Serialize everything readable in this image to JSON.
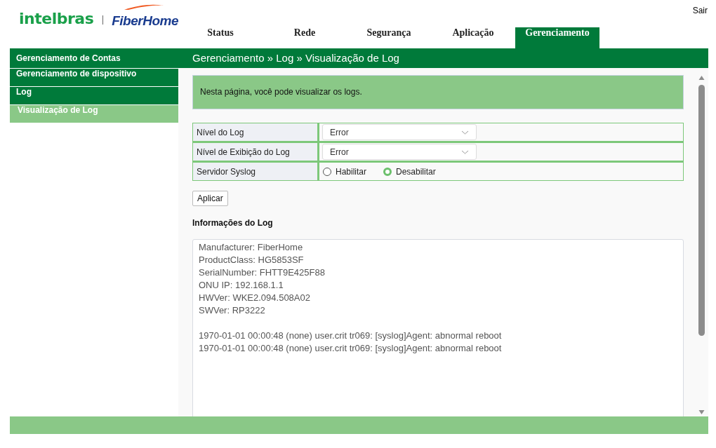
{
  "header": {
    "logo": {
      "brand": "intelbras",
      "partner": "FiberHome"
    },
    "logout": "Sair"
  },
  "tabs": [
    {
      "label": "Status",
      "selected": false
    },
    {
      "label": "Rede",
      "selected": false
    },
    {
      "label": "Segurança",
      "selected": false
    },
    {
      "label": "Aplicação",
      "selected": false
    },
    {
      "label": "Gerenciamento",
      "selected": true
    }
  ],
  "sidebar": {
    "items": [
      {
        "label": "Gerenciamento de Contas",
        "selected": false
      },
      {
        "label": "Gerenciamento de dispositivo",
        "selected": false
      },
      {
        "label": "Log",
        "selected": false,
        "children": [
          {
            "label": "Visualização de Log",
            "selected": true
          }
        ]
      }
    ]
  },
  "breadcrumb": "Gerenciamento » Log » Visualização de Log",
  "info": "Nesta página, você pode visualizar os logs.",
  "form": {
    "rows": [
      {
        "kind": "select",
        "label": "Nível do Log",
        "value": "Error"
      },
      {
        "kind": "select",
        "label": "Nível de Exibição do Log",
        "value": "Error"
      },
      {
        "kind": "radio",
        "label": "Servidor Syslog",
        "options": [
          {
            "label": "Habilitar",
            "selected": false
          },
          {
            "label": "Desabilitar",
            "selected": true
          }
        ]
      }
    ]
  },
  "apply_button": "Aplicar",
  "log_section": {
    "title": "Informações do Log",
    "device_info": [
      "Manufacturer: FiberHome",
      "ProductClass: HG5853SF",
      "SerialNumber: FHTT9E425F88",
      "ONU IP: 192.168.1.1",
      "HWVer: WKE2.094.508A02",
      "SWVer: RP3222"
    ],
    "entries": [
      "1970-01-01 00:00:48 (none) user.crit tr069: [syslog]Agent: abnormal reboot",
      "1970-01-01 00:00:48 (none) user.crit tr069: [syslog]Agent: abnormal reboot"
    ]
  }
}
